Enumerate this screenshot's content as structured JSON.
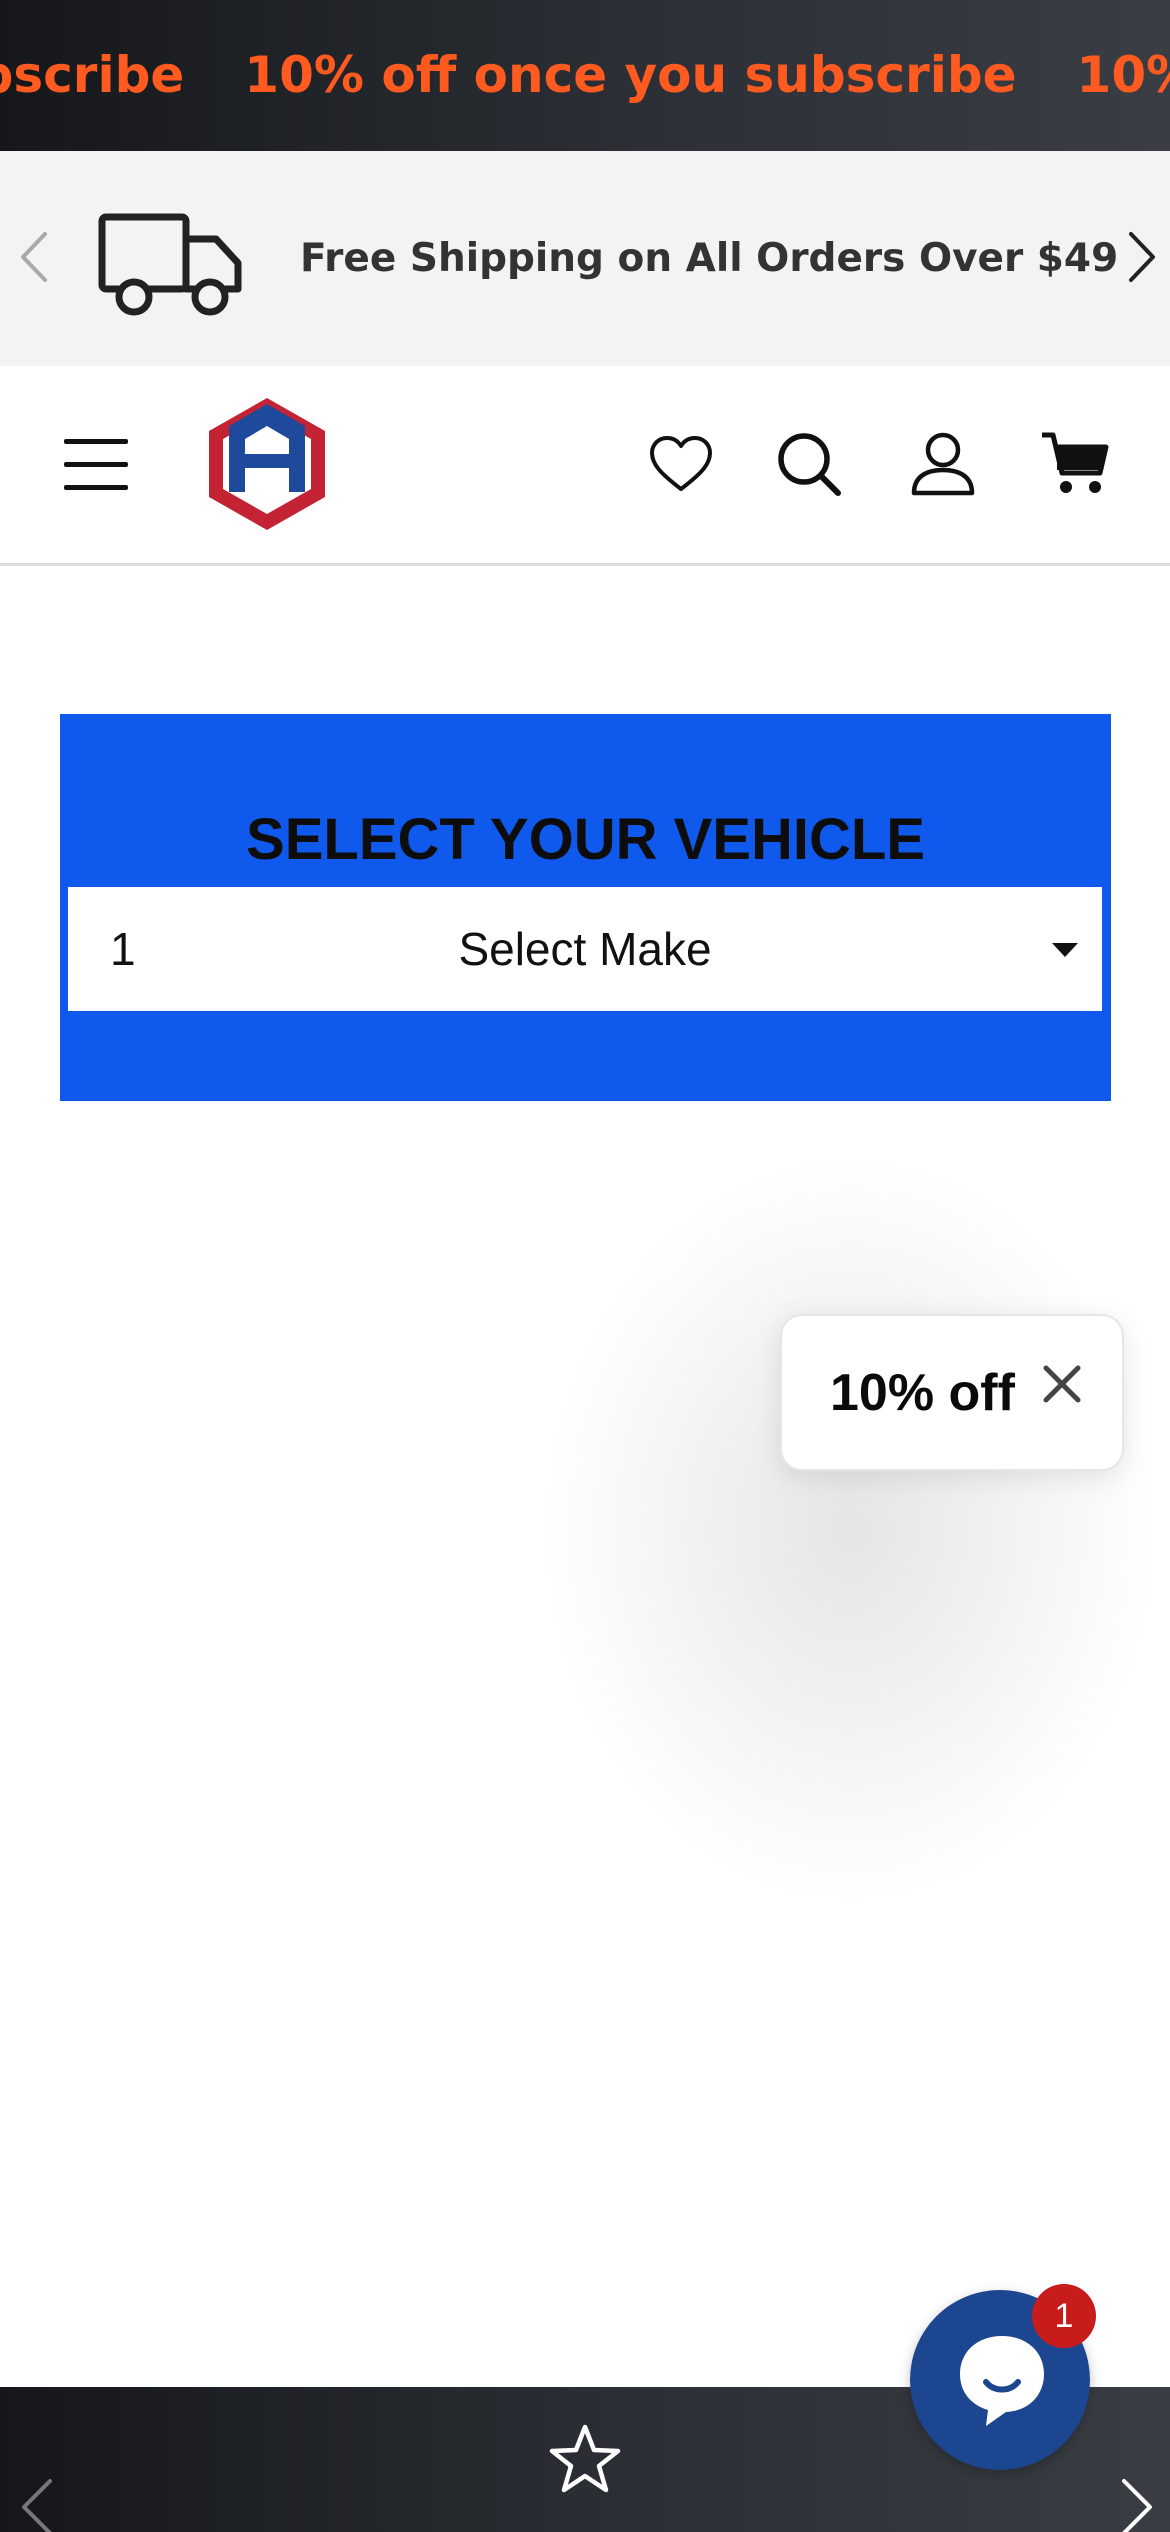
{
  "announcement": {
    "promo_text": "10% off once you subscribe",
    "color": "#ff5a1f"
  },
  "shipping_bar": {
    "text": "Free Shipping on All Orders Over $49",
    "icon": "truck-icon"
  },
  "header": {
    "icons": [
      "menu-icon",
      "logo",
      "heart-icon",
      "search-icon",
      "user-icon",
      "cart-icon"
    ]
  },
  "vehicle_selector": {
    "title": "SELECT YOUR VEHICLE",
    "step_number": "1",
    "select_label": "Select Make",
    "background_color": "#0f5aec"
  },
  "discount_popup": {
    "text": "10% off"
  },
  "chat": {
    "badge_count": "1",
    "color": "#1d4690"
  },
  "bottom_bar": {
    "icon": "star-icon"
  }
}
